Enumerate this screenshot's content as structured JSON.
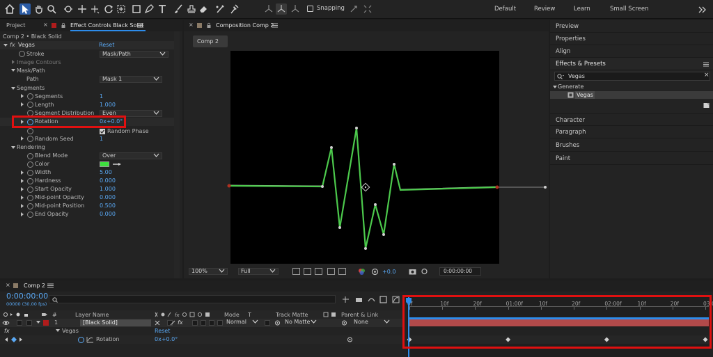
{
  "toolbar": {
    "snapping_label": "Snapping",
    "workspaces": [
      "Default",
      "Review",
      "Learn",
      "Small Screen"
    ],
    "icons": [
      "home-icon",
      "selection-arrow-icon",
      "hand-icon",
      "zoom-icon",
      "rotate-orbit-icon",
      "move-icon",
      "dolly-icon",
      "rotation-icon",
      "pan-behind-icon",
      "rectangle-icon",
      "pen-icon",
      "type-icon",
      "brush-icon",
      "clone-stamp-icon",
      "eraser-icon",
      "roto-brush-icon",
      "puppet-pin-icon"
    ]
  },
  "project_panel": {
    "project_tab": "Project",
    "effect_controls_tab": "Effect Controls Black Solid",
    "layer_path": "Comp 2 • Black Solid"
  },
  "effect_controls": {
    "fx_label": "fx",
    "effect_name": "Vegas",
    "reset_label": "Reset",
    "stroke_label": "Stroke",
    "stroke_value": "Mask/Path",
    "image_contours_label": "Image Contours",
    "mask_path_label": "Mask/Path",
    "path_label": "Path",
    "path_value": "Mask 1",
    "segments_group_label": "Segments",
    "segments_label": "Segments",
    "segments_value": "1",
    "length_label": "Length",
    "length_value": "1.000",
    "segment_distribution_label": "Segment Distribution",
    "segment_distribution_value": "Even",
    "rotation_label": "Rotation",
    "rotation_value": "0x+0.0°",
    "random_phase_label": "Random Phase",
    "random_seed_label": "Random Seed",
    "random_seed_value": "1",
    "rendering_label": "Rendering",
    "blend_mode_label": "Blend Mode",
    "blend_mode_value": "Over",
    "color_label": "Color",
    "color_value": "#3ee03e",
    "width_label": "Width",
    "width_value": "5.00",
    "hardness_label": "Hardness",
    "hardness_value": "0.000",
    "start_opacity_label": "Start Opacity",
    "start_opacity_value": "1.000",
    "midpoint_opacity_label": "Mid-point Opacity",
    "midpoint_opacity_value": "0.000",
    "midpoint_position_label": "Mid-point Position",
    "midpoint_position_value": "0.500",
    "end_opacity_label": "End Opacity",
    "end_opacity_value": "0.000"
  },
  "composition": {
    "tab_label": "Composition Comp 2",
    "comp_chip": "Comp 2",
    "zoom_value": "100%",
    "resolution_value": "Full",
    "exposure_value": "+0.0",
    "timecode": "0:00:00:00",
    "stroke_color": "#4cc94c"
  },
  "right_panel": {
    "items_top": [
      "Preview",
      "Properties",
      "Align"
    ],
    "effects_presets_label": "Effects & Presets",
    "search_value": "Vegas",
    "category_label": "Generate",
    "result_label": "Vegas",
    "items_bottom": [
      "Character",
      "Paragraph",
      "Brushes",
      "Paint"
    ]
  },
  "timeline": {
    "comp_tab": "Comp 2",
    "timecode": "0:00:00:00",
    "fps_label": "00000 (30.00 fps)",
    "search_placeholder": "",
    "col_layer_name": "Layer Name",
    "col_mode": "Mode",
    "col_track_matte": "Track Matte",
    "col_parent": "Parent & Link",
    "layer_number": "1",
    "layer_name": "[Black Solid]",
    "layer_mode": "Normal",
    "layer_matte": "No Matte",
    "layer_parent": "None",
    "effect_row_label": "Vegas",
    "effect_row_reset": "Reset",
    "fx_symbol": "fx",
    "rotation_label": "Rotation",
    "rotation_value": "0x+0.0°",
    "ruler_ticks": [
      "0f",
      "10f",
      "20f",
      "01:00f",
      "10f",
      "20f",
      "02:00f",
      "10f",
      "20f",
      "03:0"
    ],
    "keyframe_times": [
      0,
      1,
      2,
      3
    ],
    "layer_bar_color": "#b24a4a"
  }
}
